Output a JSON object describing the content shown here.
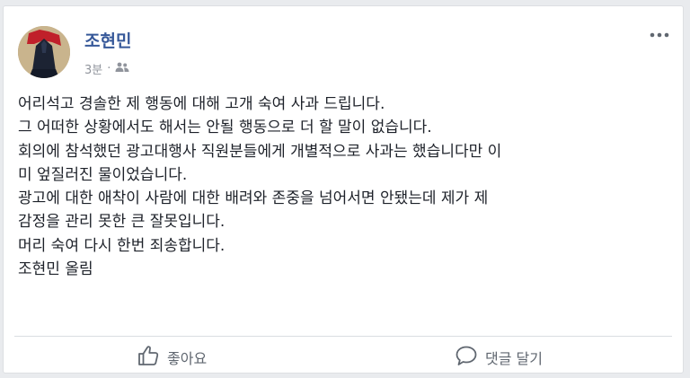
{
  "post": {
    "author": "조현민",
    "time": "3분",
    "audience_icon": "friends-icon",
    "more_icon": "more-options-icon",
    "lines": [
      "어리석고 경솔한 제 행동에 대해 고개 숙여 사과 드립니다.",
      "그 어떠한 상황에서도 해서는 안될 행동으로 더 할 말이 없습니다.",
      "회의에 참석했던 광고대행사 직원분들에게 개별적으로 사과는 했습니다만 이",
      "미 엎질러진 물이었습니다.",
      "광고에 대한 애착이 사람에 대한 배려와 존중을 넘어서면 안됐는데 제가 제",
      "감정을 관리 못한 큰 잘못입니다.",
      "머리 숙여 다시 한번 죄송합니다.",
      "조현민 올림"
    ]
  },
  "actions": {
    "like_label": "좋아요",
    "like_icon": "thumbs-up-icon",
    "comment_label": "댓글 달기",
    "comment_icon": "comment-bubble-icon"
  },
  "colors": {
    "author": "#365899",
    "text": "#1d2129",
    "muted": "#90949c",
    "action": "#606770"
  }
}
